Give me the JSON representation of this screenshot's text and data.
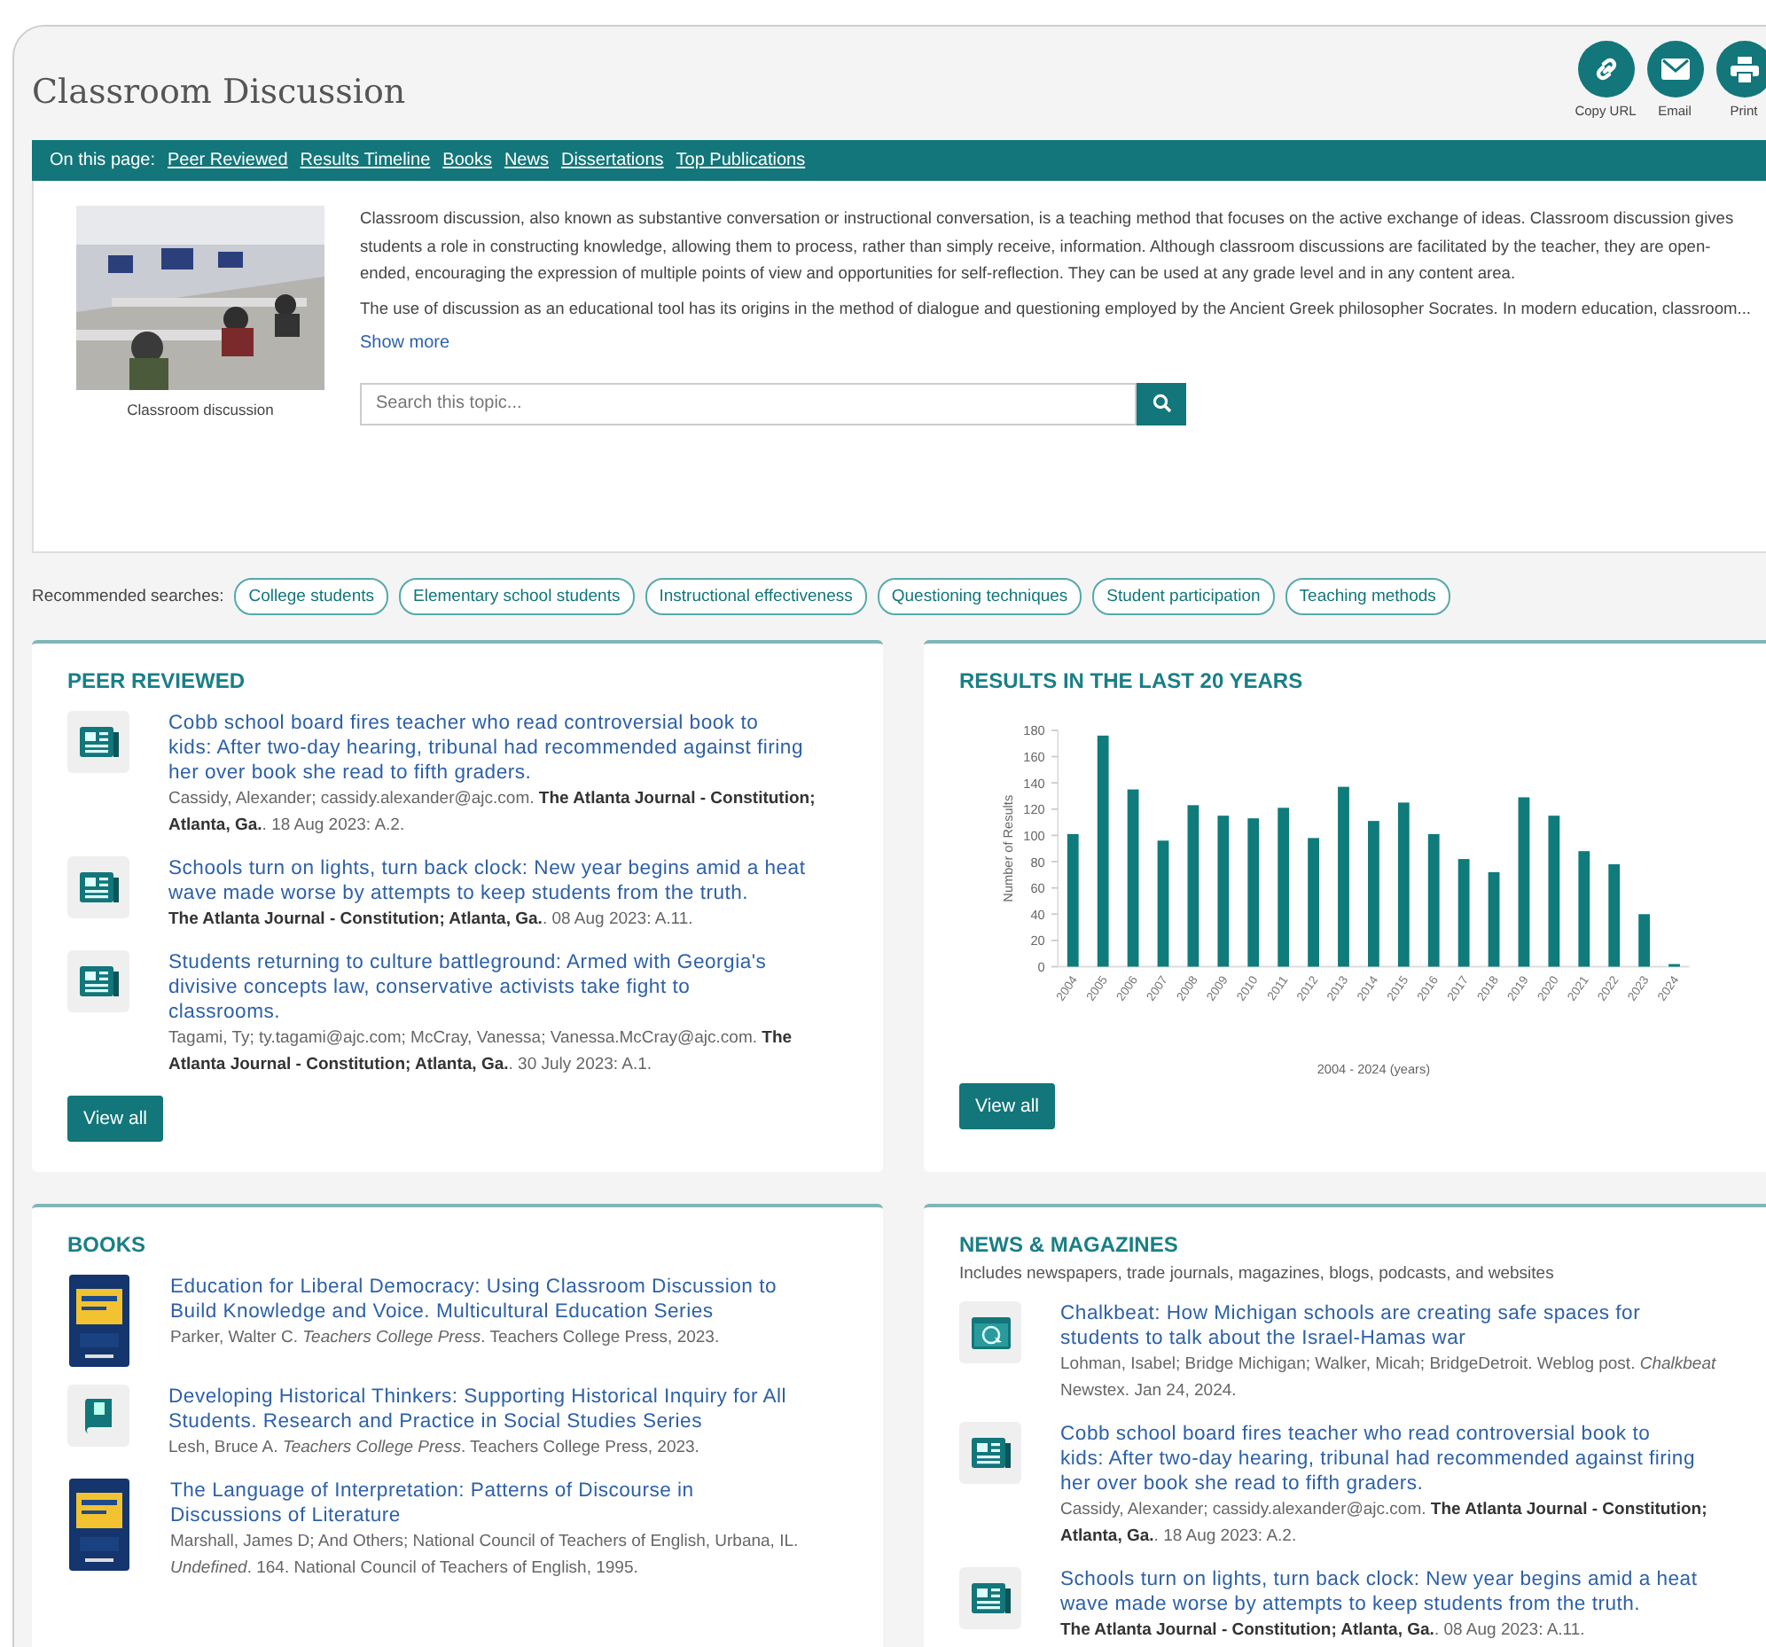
{
  "header": {
    "title": "Classroom Discussion",
    "actions": [
      {
        "label": "Copy URL",
        "kind": "link"
      },
      {
        "label": "Email",
        "kind": "email"
      },
      {
        "label": "Print",
        "kind": "print"
      }
    ]
  },
  "page_nav": {
    "label": "On this page:",
    "links": [
      "Peer Reviewed",
      "Results Timeline",
      "Books",
      "News",
      "Dissertations",
      "Top Publications"
    ]
  },
  "overview": {
    "picture": {
      "caption": "Classroom discussion"
    },
    "paragraphs": [
      "Classroom discussion, also known as substantive conversation or instructional conversation, is a teaching method that focuses on the active exchange of ideas. Classroom discussion gives students a role in constructing knowledge, allowing them to process, rather than simply receive, information. Although classroom discussions are facilitated by the teacher, they are open-ended, encouraging the expression of multiple points of view and opportunities for self-reflection. They can be used at any grade level and in any content area.",
      "The use of discussion as an educational tool has its origins in the method of dialogue and questioning employed by the Ancient Greek philosopher Socrates. In modern education, classroom..."
    ],
    "show_more": "Show more",
    "search": {
      "placeholder": "Search this topic..."
    }
  },
  "recommended": {
    "label": "Recommended searches:",
    "tags": [
      "College students",
      "Elementary school students",
      "Instructional effectiveness",
      "Questioning techniques",
      "Student participation",
      "Teaching methods"
    ]
  },
  "peer_reviewed": {
    "title": "PEER REVIEWED",
    "items": [
      {
        "kind": "article",
        "title": "Cobb school board fires teacher who read controversial book to kids: After two-day hearing, tribunal had recommended against firing her over book she read to fifth graders.",
        "citation": "Cassidy, Alexander; cassidy.alexander@ajc.com. **The Atlanta Journal - Constitution; Atlanta, Ga.**. 18 Aug 2023: A.2."
      },
      {
        "kind": "article",
        "title": "Schools turn on lights, turn back clock: New year begins amid a heat wave made worse by attempts to keep students from the truth.",
        "citation": "**The Atlanta Journal - Constitution; Atlanta, Ga.**. 08 Aug 2023: A.11."
      },
      {
        "kind": "article",
        "title": "Students returning to culture battleground: Armed with Georgia's divisive concepts law, conservative activists take fight to classrooms.",
        "citation": "Tagami, Ty; ty.tagami@ajc.com; McCray, Vanessa; Vanessa.McCray@ajc.com. **The Atlanta Journal - Constitution; Atlanta, Ga.**. 30 July 2023: A.1."
      }
    ],
    "button": "View all"
  },
  "results": {
    "title": "RESULTS IN THE LAST 20 YEARS",
    "chart_data": {
      "type": "bar",
      "xlabel": "2004 - 2024 (years)",
      "ylabel": "Number of Results",
      "categories": [
        "2004",
        "2005",
        "2006",
        "2007",
        "2008",
        "2009",
        "2010",
        "2011",
        "2012",
        "2013",
        "2014",
        "2015",
        "2016",
        "2017",
        "2018",
        "2019",
        "2020",
        "2021",
        "2022",
        "2023",
        "2024"
      ],
      "series": [
        {
          "color": "#0f7b7b",
          "values": [
            101,
            176,
            135,
            96,
            123,
            115,
            113,
            121,
            98,
            137,
            111,
            125,
            101,
            82,
            72,
            129,
            115,
            88,
            78,
            40,
            2
          ]
        }
      ],
      "ylim": [
        0,
        180
      ],
      "yticks": [
        0,
        20,
        40,
        60,
        80,
        100,
        120,
        140,
        160,
        180
      ]
    },
    "button": "View all"
  },
  "books": {
    "title": "BOOKS",
    "items": [
      {
        "kind": "cover",
        "title": "Education for Liberal Democracy: Using Classroom Discussion to Build Knowledge and Voice. Multicultural Education Series",
        "citation": "Parker, Walter C. *Teachers College Press*. Teachers College Press, 2023."
      },
      {
        "kind": "book",
        "title": "Developing Historical Thinkers: Supporting Historical Inquiry for All Students. Research and Practice in Social Studies Series",
        "citation": "Lesh, Bruce A. *Teachers College Press*. Teachers College Press, 2023."
      },
      {
        "kind": "cover",
        "title": "The Language of Interpretation: Patterns of Discourse in Discussions of Literature",
        "citation": "Marshall, James D; And Others; National Council of Teachers of English, Urbana, IL. *Undefined*. 164. National Council of Teachers of English, 1995."
      }
    ]
  },
  "news": {
    "title": "NEWS & MAGAZINES",
    "subtitle": "Includes newspapers, trade journals, magazines, blogs, podcasts, and websites",
    "items": [
      {
        "kind": "web",
        "title": "Chalkbeat: How Michigan schools are creating safe spaces for students to talk about the Israel-Hamas war",
        "citation": "Lohman, Isabel; Bridge Michigan; Walker, Micah; BridgeDetroit. Weblog post. *Chalkbeat* Newstex. Jan 24, 2024."
      },
      {
        "kind": "article",
        "title": "Cobb school board fires teacher who read controversial book to kids: After two-day hearing, tribunal had recommended against firing her over book she read to fifth graders.",
        "citation": "Cassidy, Alexander; cassidy.alexander@ajc.com. **The Atlanta Journal - Constitution; Atlanta, Ga.**. 18 Aug 2023: A.2."
      },
      {
        "kind": "article",
        "title": "Schools turn on lights, turn back clock: New year begins amid a heat wave made worse by attempts to keep students from the truth.",
        "citation": "**The Atlanta Journal - Constitution; Atlanta, Ga.**. 08 Aug 2023: A.11."
      }
    ]
  }
}
